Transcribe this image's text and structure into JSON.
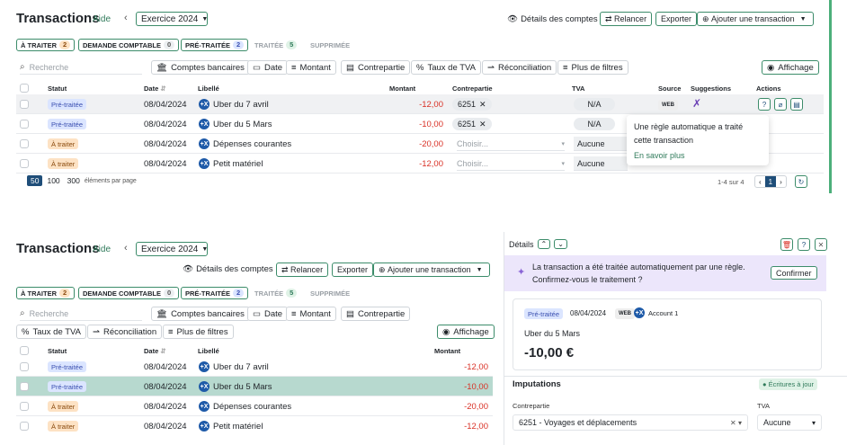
{
  "top": {
    "title": "Transactions",
    "help": "Aide",
    "exercise": "Exercice 2024",
    "details_link": "Détails des comptes",
    "relancer": "Relancer",
    "exporter": "Exporter",
    "add_tx": "Ajouter une transaction",
    "tabs": [
      {
        "label": "À TRAITER",
        "count": "2"
      },
      {
        "label": "DEMANDE COMPTABLE",
        "count": "0"
      },
      {
        "label": "PRÉ-TRAITÉE",
        "count": "2"
      },
      {
        "label": "TRAITÉE",
        "count": "5"
      },
      {
        "label": "SUPPRIMÉE",
        "count": ""
      }
    ],
    "search_placeholder": "Recherche",
    "filters": [
      "Comptes bancaires",
      "Date",
      "Montant",
      "Contrepartie",
      "Taux de TVA",
      "Réconciliation",
      "Plus de filtres"
    ],
    "display": "Affichage",
    "headers": {
      "status": "Statut",
      "date": "Date",
      "label": "Libellé",
      "amount": "Montant",
      "counterpart": "Contrepartie",
      "vat": "TVA",
      "source": "Source",
      "suggestions": "Suggestions",
      "actions": "Actions"
    },
    "rows": [
      {
        "status": "Pré-traitée",
        "date": "08/04/2024",
        "label": "Uber du 7 avril",
        "amount": "-12,00",
        "counterpart": "6251",
        "vat": "N/A"
      },
      {
        "status": "Pré-traitée",
        "date": "08/04/2024",
        "label": "Uber du 5 Mars",
        "amount": "-10,00",
        "counterpart": "6251",
        "vat": "N/A"
      },
      {
        "status": "À traiter",
        "date": "08/04/2024",
        "label": "Dépenses courantes",
        "amount": "-20,00",
        "counterpart": "Choisir...",
        "vat": "Aucune"
      },
      {
        "status": "À traiter",
        "date": "08/04/2024",
        "label": "Petit matériel",
        "amount": "-12,00",
        "counterpart": "Choisir...",
        "vat": "Aucune"
      }
    ],
    "source_tag": "WEB",
    "tooltip": {
      "text": "Une règle automatique a traité cette transaction",
      "link": "En savoir plus"
    },
    "page_sizes": [
      "50",
      "100",
      "300"
    ],
    "per_page": "éléments par page",
    "range": "1-4 sur 4",
    "page": "1"
  },
  "bottom": {
    "title": "Transactions",
    "help": "Aide",
    "exercise": "Exercice 2024",
    "details_link": "Détails des comptes",
    "relancer": "Relancer",
    "exporter": "Exporter",
    "add_tx": "Ajouter une transaction",
    "tabs": [
      {
        "label": "À TRAITER",
        "count": "2"
      },
      {
        "label": "DEMANDE COMPTABLE",
        "count": "0"
      },
      {
        "label": "PRÉ-TRAITÉE",
        "count": "2"
      },
      {
        "label": "TRAITÉE",
        "count": "5"
      },
      {
        "label": "SUPPRIMÉE",
        "count": ""
      }
    ],
    "search_placeholder": "Recherche",
    "filters": [
      "Comptes bancaires",
      "Date",
      "Montant",
      "Contrepartie",
      "Taux de TVA",
      "Réconciliation",
      "Plus de filtres"
    ],
    "display": "Affichage",
    "headers": {
      "status": "Statut",
      "date": "Date",
      "label": "Libellé",
      "amount": "Montant"
    },
    "rows": [
      {
        "status": "Pré-traitée",
        "date": "08/04/2024",
        "label": "Uber du 7 avril",
        "amount": "-12,00"
      },
      {
        "status": "Pré-traitée",
        "date": "08/04/2024",
        "label": "Uber du 5 Mars",
        "amount": "-10,00"
      },
      {
        "status": "À traiter",
        "date": "08/04/2024",
        "label": "Dépenses courantes",
        "amount": "-20,00"
      },
      {
        "status": "À traiter",
        "date": "08/04/2024",
        "label": "Petit matériel",
        "amount": "-12,00"
      }
    ]
  },
  "detail": {
    "title": "Détails",
    "banner": "La transaction a été traitée automatiquement par une règle. Confirmez-vous le traitement ?",
    "confirm": "Confirmer",
    "status": "Pré-traitée",
    "date": "08/04/2024",
    "source_tag": "WEB",
    "account": "Account 1",
    "label": "Uber du 5 Mars",
    "amount": "-10,00 €",
    "imputations": "Imputations",
    "entries_ok": "Écritures à jour",
    "counterpart_label": "Contrepartie",
    "vat_label": "TVA",
    "counterpart_value": "6251 - Voyages et déplacements",
    "vat_value": "Aucune"
  },
  "colors": {
    "accent": "#3c8c6a",
    "negative": "#d93025",
    "badge_pre": "#dbe5ff",
    "badge_todo": "#fde2c4",
    "selected_row": "#b7d9cf"
  }
}
